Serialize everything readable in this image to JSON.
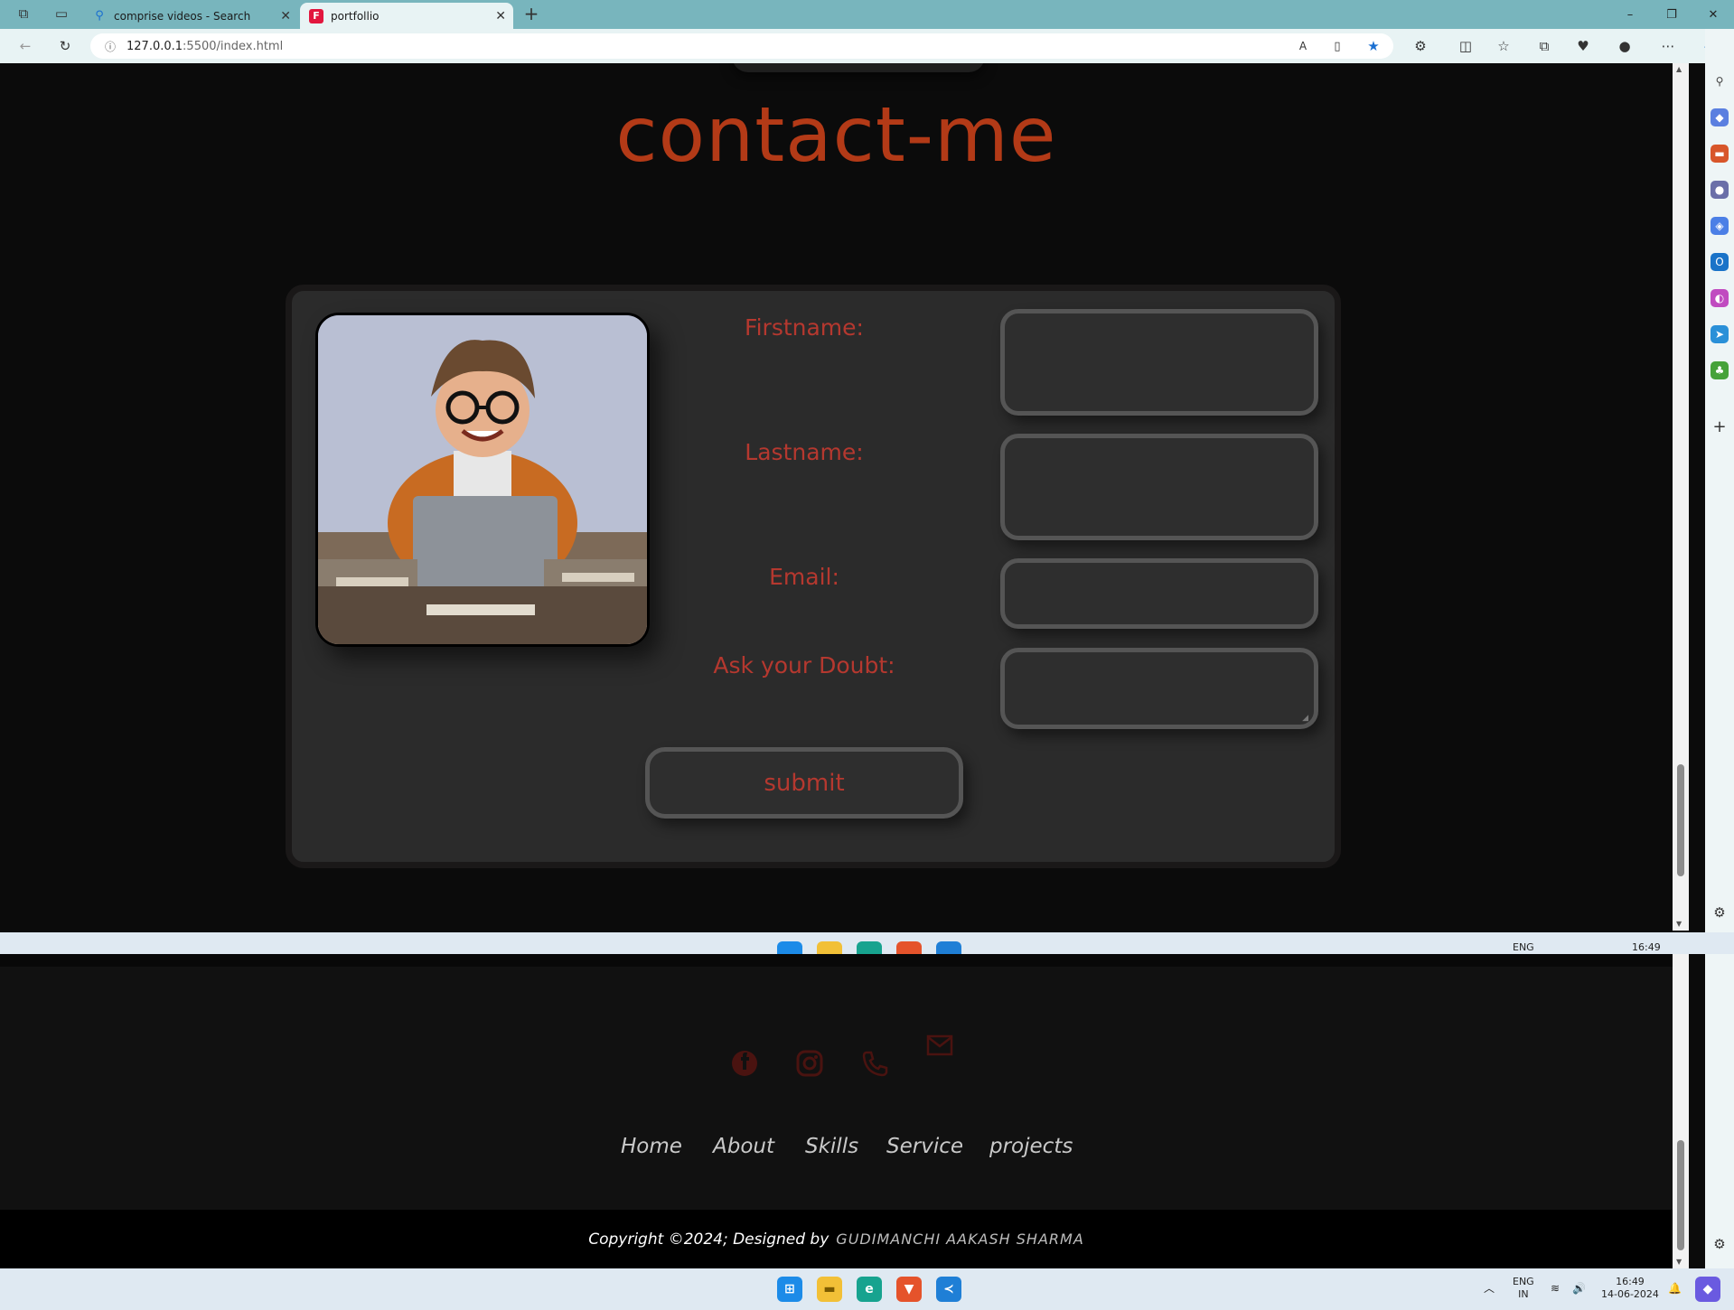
{
  "browser": {
    "tabs": [
      {
        "title": "comprise videos - Search",
        "icon": "search-icon",
        "active": false
      },
      {
        "title": "portfollio",
        "icon": "portfolio-favicon",
        "active": true
      }
    ],
    "new_tab_label": "+",
    "url_host": "127.0.0.1",
    "url_rest": ":5500/index.html",
    "colors": {
      "tabstrip": "#78b5bd",
      "addressbar": "#e8f3f4"
    }
  },
  "contact": {
    "title": "contact-me",
    "labels": {
      "firstname": "Firstname:",
      "lastname": "Lastname:",
      "email": "Email:",
      "doubt": "Ask your Doubt:"
    },
    "submit_label": "submit",
    "colors": {
      "accent": "#b33a17",
      "label": "#b5382f",
      "card": "#2b2b2b"
    }
  },
  "footer": {
    "social_icons": [
      "facebook-icon",
      "instagram-icon",
      "phone-icon",
      "mail-icon"
    ],
    "nav": [
      "Home",
      "About",
      "Skills",
      "Service",
      "projects"
    ],
    "copyright_text": "Copyright ©2024; Designed by",
    "designer": "GUDIMANCHI AAKASH SHARMA"
  },
  "taskbar": {
    "apps": [
      "windows-start-icon",
      "file-explorer-icon",
      "edge-icon",
      "brave-icon",
      "vscode-icon"
    ],
    "lang_top": "ENG",
    "lang_bottom": "IN",
    "time": "16:49",
    "date": "14-06-2024",
    "mid_lang": "ENG",
    "mid_time": "16:49"
  }
}
